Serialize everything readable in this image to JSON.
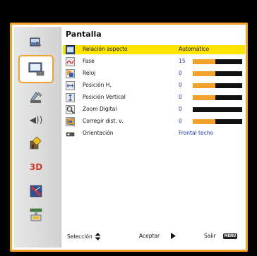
{
  "menu": {
    "title": "Pantalla",
    "rows": [
      {
        "label": "Relación aspecto",
        "value": "Automático"
      },
      {
        "label": "Fase",
        "value": "15",
        "level": 0.45
      },
      {
        "label": "Reloj",
        "value": "0",
        "level": 0.45
      },
      {
        "label": "Posición H.",
        "value": "0",
        "level": 0.45
      },
      {
        "label": "Posición Vertical",
        "value": "0",
        "level": 0.45
      },
      {
        "label": "Zoom Digital",
        "value": "0",
        "level": 0.0
      },
      {
        "label": "Corregir dist. v.",
        "value": "0",
        "level": 0.45
      },
      {
        "label": "Orientación",
        "value": "Frontal techo"
      }
    ]
  },
  "sidebar": {
    "items": [
      {
        "icon": "picture-adjust-icon"
      },
      {
        "icon": "display-icon",
        "active": true
      },
      {
        "icon": "setup-icon"
      },
      {
        "icon": "volume-icon",
        "text": "◀))"
      },
      {
        "icon": "options-icon"
      },
      {
        "icon": "3d-icon",
        "text": "3D"
      },
      {
        "icon": "lamp-icon"
      },
      {
        "icon": "network-icon"
      }
    ]
  },
  "footer": {
    "select_label": "Selección",
    "accept_label": "Aceptar",
    "exit_label": "Salir",
    "exit_badge": "MENU"
  },
  "colors": {
    "accent": "#f2a12a",
    "highlight": "#ffe400",
    "value_text": "#1b3ad0"
  }
}
